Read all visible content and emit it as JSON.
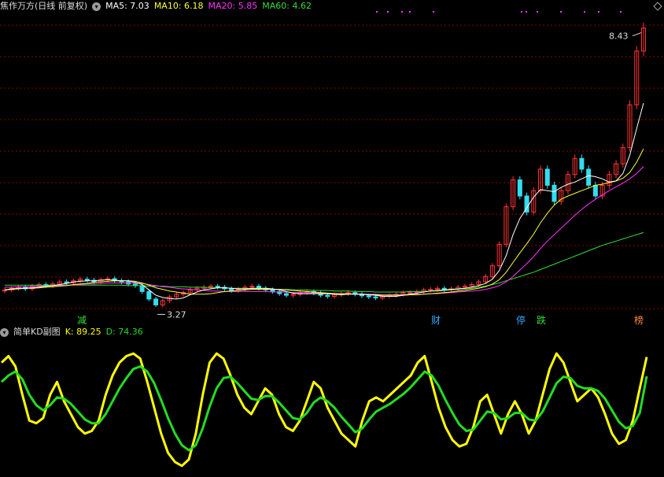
{
  "title": "焦作万方(日线 前复权)",
  "ma": {
    "ma5": {
      "label": "MA5: 7.03",
      "color": "#ffffff"
    },
    "ma10": {
      "label": "MA10: 6.18",
      "color": "#ffff33"
    },
    "ma20": {
      "label": "MA20: 5.85",
      "color": "#ff33ff"
    },
    "ma60": {
      "label": "MA60: 4.62",
      "color": "#33dd33"
    }
  },
  "price": {
    "high_label": "8.43",
    "low_label": "3.27"
  },
  "tags": [
    {
      "text": "减",
      "color": "#33dd33"
    },
    {
      "text": "财",
      "color": "#33aaff"
    },
    {
      "text": "停",
      "color": "#33aaff"
    },
    {
      "text": "跌",
      "color": "#33dd33"
    },
    {
      "text": "榜",
      "color": "#ff8833"
    }
  ],
  "kd": {
    "title": "简单KD副图",
    "k_label": "K: 89.25",
    "d_label": "D: 74.36",
    "k_color": "#ffff00",
    "d_color": "#22dd22"
  },
  "colors": {
    "up": "#ff3333",
    "down": "#33ddee",
    "grid": "#8b0000"
  },
  "series": {
    "close": [
      3.55,
      3.58,
      3.6,
      3.57,
      3.62,
      3.65,
      3.63,
      3.66,
      3.7,
      3.68,
      3.72,
      3.75,
      3.73,
      3.7,
      3.74,
      3.76,
      3.72,
      3.7,
      3.66,
      3.63,
      3.52,
      3.38,
      3.27,
      3.35,
      3.42,
      3.47,
      3.5,
      3.55,
      3.58,
      3.6,
      3.62,
      3.6,
      3.57,
      3.54,
      3.56,
      3.6,
      3.62,
      3.58,
      3.55,
      3.52,
      3.48,
      3.45,
      3.47,
      3.5,
      3.52,
      3.49,
      3.45,
      3.43,
      3.46,
      3.48,
      3.5,
      3.47,
      3.44,
      3.42,
      3.4,
      3.43,
      3.45,
      3.47,
      3.5,
      3.5,
      3.52,
      3.55,
      3.56,
      3.58,
      3.55,
      3.57,
      3.6,
      3.62,
      3.65,
      3.7,
      3.8,
      4.0,
      4.4,
      5.1,
      5.6,
      5.3,
      5.0,
      5.4,
      5.8,
      5.5,
      5.2,
      5.4,
      5.7,
      6.0,
      5.8,
      5.5,
      5.3,
      5.5,
      5.7,
      5.9,
      6.2,
      7.0,
      8.0,
      8.43
    ],
    "ma5": [
      3.55,
      3.57,
      3.58,
      3.58,
      3.59,
      3.6,
      3.62,
      3.63,
      3.65,
      3.67,
      3.7,
      3.71,
      3.72,
      3.72,
      3.73,
      3.74,
      3.73,
      3.72,
      3.72,
      3.69,
      3.65,
      3.55,
      3.45,
      3.41,
      3.39,
      3.38,
      3.4,
      3.46,
      3.51,
      3.55,
      3.57,
      3.59,
      3.59,
      3.58,
      3.57,
      3.57,
      3.58,
      3.58,
      3.58,
      3.57,
      3.55,
      3.52,
      3.49,
      3.48,
      3.48,
      3.48,
      3.48,
      3.48,
      3.47,
      3.46,
      3.47,
      3.47,
      3.47,
      3.46,
      3.45,
      3.43,
      3.43,
      3.43,
      3.45,
      3.47,
      3.49,
      3.51,
      3.53,
      3.54,
      3.55,
      3.56,
      3.57,
      3.58,
      3.6,
      3.63,
      3.67,
      3.75,
      3.91,
      4.19,
      4.58,
      4.88,
      5.08,
      5.28,
      5.42,
      5.4,
      5.38,
      5.46,
      5.52,
      5.56,
      5.62,
      5.68,
      5.66,
      5.62,
      5.56,
      5.58,
      5.72,
      6.06,
      6.56,
      7.03
    ],
    "ma10": [
      3.55,
      3.56,
      3.57,
      3.58,
      3.58,
      3.59,
      3.6,
      3.61,
      3.62,
      3.63,
      3.65,
      3.66,
      3.67,
      3.69,
      3.7,
      3.71,
      3.72,
      3.72,
      3.72,
      3.71,
      3.68,
      3.64,
      3.59,
      3.56,
      3.53,
      3.51,
      3.49,
      3.47,
      3.47,
      3.47,
      3.48,
      3.5,
      3.52,
      3.53,
      3.54,
      3.55,
      3.56,
      3.56,
      3.56,
      3.56,
      3.56,
      3.55,
      3.54,
      3.53,
      3.52,
      3.51,
      3.5,
      3.49,
      3.48,
      3.48,
      3.48,
      3.47,
      3.47,
      3.46,
      3.46,
      3.45,
      3.45,
      3.45,
      3.45,
      3.46,
      3.46,
      3.47,
      3.48,
      3.49,
      3.5,
      3.51,
      3.53,
      3.54,
      3.56,
      3.58,
      3.61,
      3.66,
      3.74,
      3.88,
      4.06,
      4.24,
      4.41,
      4.59,
      4.8,
      4.98,
      5.13,
      5.24,
      5.3,
      5.35,
      5.4,
      5.45,
      5.5,
      5.52,
      5.55,
      5.58,
      5.63,
      5.74,
      5.93,
      6.18
    ],
    "ma20": [
      3.6,
      3.6,
      3.61,
      3.61,
      3.61,
      3.62,
      3.62,
      3.63,
      3.63,
      3.64,
      3.64,
      3.65,
      3.66,
      3.66,
      3.67,
      3.68,
      3.68,
      3.68,
      3.68,
      3.68,
      3.67,
      3.65,
      3.63,
      3.61,
      3.6,
      3.58,
      3.57,
      3.56,
      3.55,
      3.54,
      3.53,
      3.53,
      3.52,
      3.52,
      3.52,
      3.52,
      3.52,
      3.52,
      3.52,
      3.51,
      3.51,
      3.51,
      3.5,
      3.5,
      3.5,
      3.49,
      3.49,
      3.49,
      3.48,
      3.48,
      3.48,
      3.47,
      3.47,
      3.47,
      3.47,
      3.46,
      3.46,
      3.46,
      3.46,
      3.46,
      3.47,
      3.47,
      3.48,
      3.48,
      3.49,
      3.5,
      3.51,
      3.52,
      3.53,
      3.54,
      3.56,
      3.59,
      3.63,
      3.7,
      3.8,
      3.92,
      4.04,
      4.17,
      4.32,
      4.46,
      4.58,
      4.7,
      4.82,
      4.94,
      5.05,
      5.15,
      5.24,
      5.32,
      5.4,
      5.47,
      5.54,
      5.62,
      5.72,
      5.85
    ],
    "ma60": [
      3.64,
      3.64,
      3.64,
      3.64,
      3.64,
      3.64,
      3.64,
      3.64,
      3.64,
      3.64,
      3.64,
      3.64,
      3.64,
      3.64,
      3.64,
      3.64,
      3.64,
      3.64,
      3.63,
      3.63,
      3.63,
      3.62,
      3.62,
      3.62,
      3.61,
      3.61,
      3.61,
      3.6,
      3.6,
      3.6,
      3.59,
      3.59,
      3.59,
      3.58,
      3.58,
      3.58,
      3.57,
      3.57,
      3.57,
      3.56,
      3.56,
      3.56,
      3.55,
      3.55,
      3.55,
      3.54,
      3.54,
      3.54,
      3.53,
      3.53,
      3.53,
      3.52,
      3.52,
      3.52,
      3.51,
      3.51,
      3.51,
      3.51,
      3.51,
      3.52,
      3.52,
      3.52,
      3.53,
      3.53,
      3.54,
      3.55,
      3.56,
      3.57,
      3.58,
      3.6,
      3.62,
      3.65,
      3.68,
      3.72,
      3.76,
      3.8,
      3.84,
      3.88,
      3.93,
      3.98,
      4.03,
      4.08,
      4.13,
      4.18,
      4.23,
      4.28,
      4.33,
      4.38,
      4.42,
      4.46,
      4.5,
      4.54,
      4.58,
      4.62
    ],
    "k": [
      85,
      90,
      82,
      60,
      40,
      38,
      42,
      60,
      70,
      55,
      45,
      35,
      30,
      32,
      40,
      60,
      75,
      85,
      90,
      92,
      88,
      70,
      50,
      30,
      15,
      8,
      5,
      10,
      30,
      60,
      85,
      92,
      88,
      75,
      60,
      50,
      45,
      55,
      65,
      60,
      45,
      35,
      32,
      40,
      55,
      70,
      65,
      50,
      40,
      30,
      25,
      20,
      40,
      55,
      58,
      55,
      60,
      65,
      70,
      75,
      85,
      90,
      70,
      50,
      35,
      25,
      20,
      22,
      35,
      55,
      60,
      45,
      30,
      45,
      55,
      45,
      30,
      40,
      60,
      80,
      92,
      85,
      70,
      55,
      60,
      65,
      58,
      45,
      30,
      22,
      25,
      40,
      65,
      89.25
    ],
    "d": [
      70,
      75,
      78,
      72,
      60,
      52,
      48,
      52,
      58,
      57,
      53,
      47,
      41,
      38,
      38,
      45,
      55,
      65,
      73,
      80,
      82,
      78,
      69,
      56,
      42,
      30,
      21,
      17,
      21,
      34,
      51,
      65,
      73,
      74,
      69,
      63,
      57,
      56,
      59,
      59,
      54,
      48,
      42,
      41,
      46,
      54,
      58,
      55,
      50,
      43,
      37,
      31,
      34,
      41,
      47,
      50,
      53,
      57,
      61,
      66,
      72,
      78,
      75,
      67,
      56,
      46,
      37,
      32,
      33,
      40,
      47,
      46,
      41,
      42,
      46,
      46,
      41,
      40,
      47,
      58,
      69,
      74,
      73,
      67,
      65,
      65,
      63,
      57,
      48,
      39,
      34,
      36,
      46,
      74.36
    ]
  }
}
